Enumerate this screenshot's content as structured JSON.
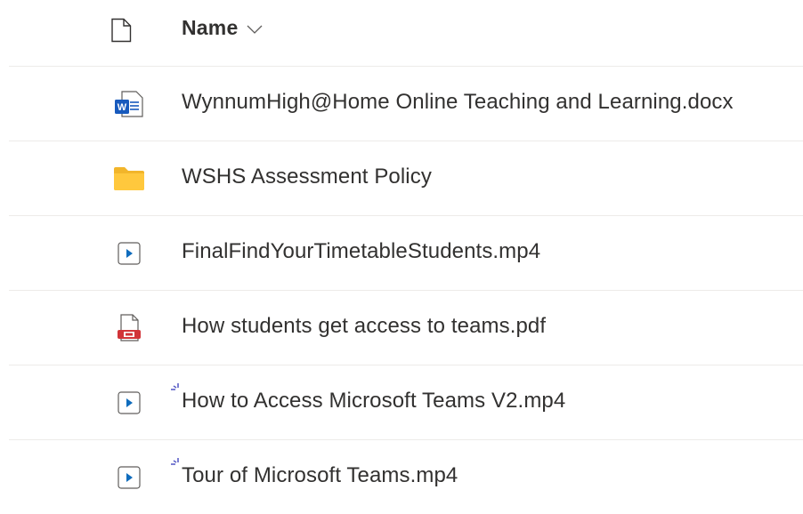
{
  "header": {
    "name_label": "Name",
    "type_icon": "file-icon",
    "sort_icon": "chevron-down-icon"
  },
  "files": [
    {
      "name": "WynnumHigh@Home Online Teaching and Learning.docx",
      "icon": "word-document-icon",
      "is_new": false
    },
    {
      "name": "WSHS Assessment Policy",
      "icon": "folder-icon",
      "is_new": false
    },
    {
      "name": "FinalFindYourTimetableStudents.mp4",
      "icon": "video-file-icon",
      "is_new": false
    },
    {
      "name": "How students get access to teams.pdf",
      "icon": "pdf-file-icon",
      "is_new": false
    },
    {
      "name": "How to Access Microsoft Teams V2.mp4",
      "icon": "video-file-icon",
      "is_new": true
    },
    {
      "name": "Tour of Microsoft Teams.mp4",
      "icon": "video-file-icon",
      "is_new": true
    }
  ],
  "colors": {
    "word_blue": "#185abd",
    "folder_yellow": "#ffc83d",
    "pdf_red": "#d13438",
    "new_badge_blue": "#5b5fc7",
    "divider": "#edebe9",
    "text": "#323130"
  }
}
